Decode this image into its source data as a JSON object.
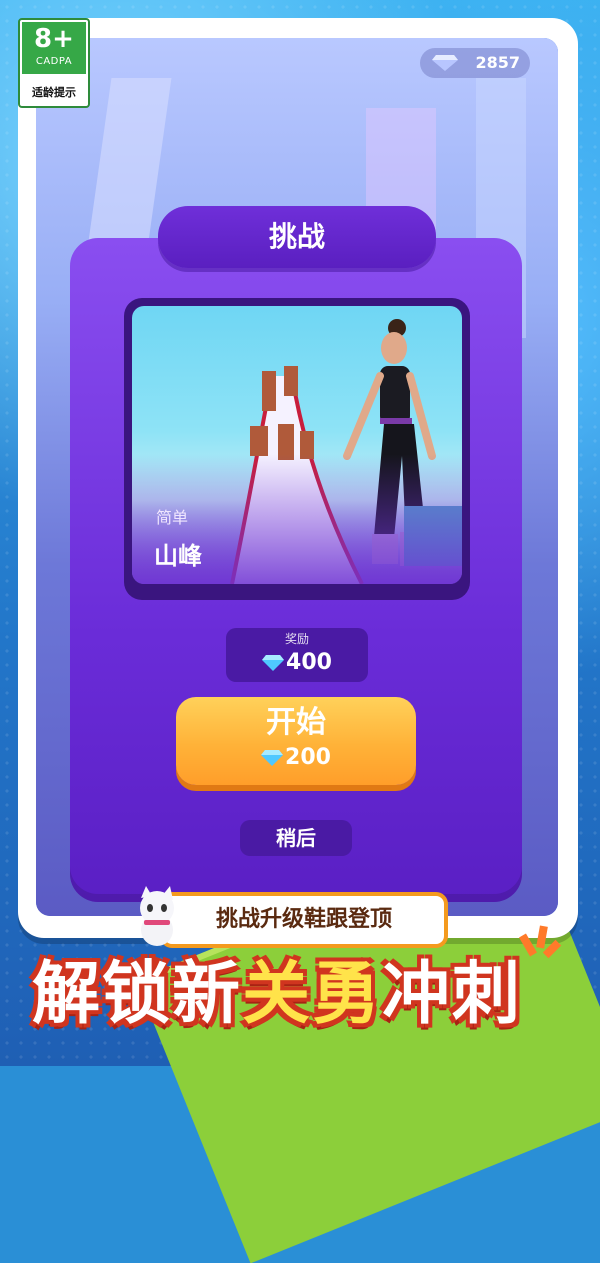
{
  "age_rating": {
    "value": "8+",
    "org": "CADPA",
    "tip": "适龄提示"
  },
  "gems": {
    "count": "2857",
    "icon": "diamond-icon"
  },
  "dialog": {
    "title": "挑战",
    "level": {
      "difficulty": "简单",
      "name": "山峰"
    },
    "reward": {
      "label": "奖励",
      "amount": "400"
    },
    "start_button": {
      "label": "开始",
      "cost": "200"
    },
    "later_button": "稍后"
  },
  "promo": {
    "subtitle": "挑战升级鞋跟登顶",
    "headline_parts": [
      "解锁新",
      "关勇",
      "冲刺"
    ]
  },
  "colors": {
    "dialog_purple": "#6a2cd8",
    "start_orange": "#ffb238",
    "banner_red": "#d0351f",
    "banner_yellow": "#ffe34a"
  }
}
